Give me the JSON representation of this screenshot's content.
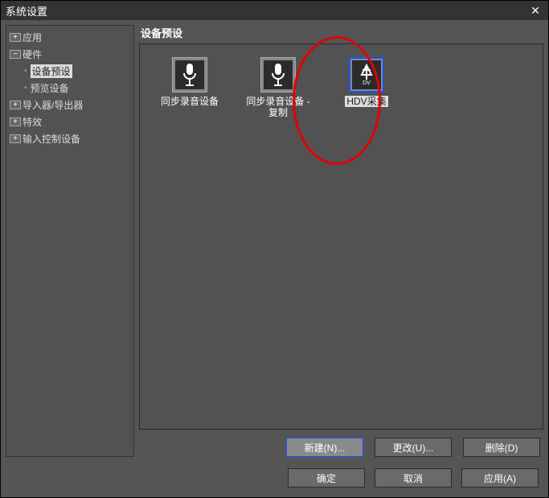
{
  "window": {
    "title": "系统设置",
    "close": "✕"
  },
  "sidebar": {
    "items": [
      {
        "label": "应用",
        "toggle": "+"
      },
      {
        "label": "硬件",
        "toggle": "−"
      },
      {
        "label": "设备预设"
      },
      {
        "label": "预览设备"
      },
      {
        "label": "导入器/导出器",
        "toggle": "+"
      },
      {
        "label": "特效",
        "toggle": "+"
      },
      {
        "label": "输入控制设备",
        "toggle": "+"
      }
    ]
  },
  "panel": {
    "title": "设备预设",
    "items": [
      {
        "label": "同步录音设备",
        "icon": "mic-icon"
      },
      {
        "label": "同步录音设备 - 复制",
        "icon": "mic-icon"
      },
      {
        "label": "HDV采集",
        "icon": "dv-icon"
      }
    ],
    "buttons": {
      "new": "新建(N)...",
      "change": "更改(U)...",
      "delete": "删除(D)"
    }
  },
  "footer": {
    "ok": "确定",
    "cancel": "取消",
    "apply": "应用(A)"
  }
}
